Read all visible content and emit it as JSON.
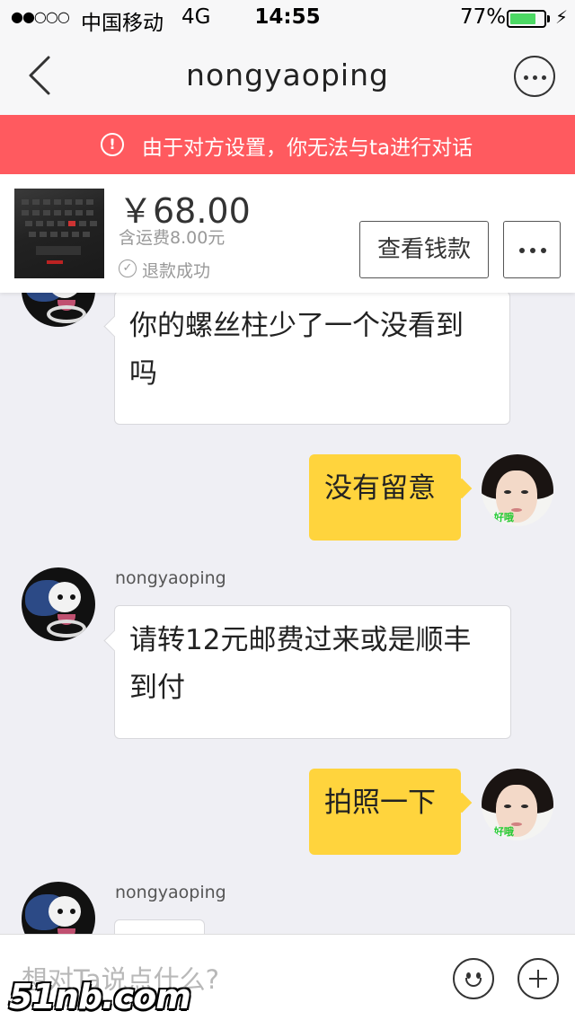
{
  "status_bar": {
    "signal": "●●○○○",
    "carrier": "中国移动",
    "network": "4G",
    "time": "14:55",
    "battery": "77%",
    "battery_level": 0.77
  },
  "nav": {
    "title": "nongyaoping"
  },
  "warning": {
    "text": "由于对方设置，你无法与ta进行对话"
  },
  "product": {
    "price": "￥68.00",
    "shipping": "含运费8.00元",
    "status": "退款成功",
    "view_button": "查看钱款"
  },
  "messages": [
    {
      "from": "other",
      "sender": "",
      "text_line1": "你的螺丝柱少了一个没看到",
      "text_line2": "吗"
    },
    {
      "from": "me",
      "text": "没有留意"
    },
    {
      "from": "other",
      "sender": "nongyaoping",
      "text_line1": "请转12元邮费过来或是顺丰",
      "text_line2": "到付"
    },
    {
      "from": "me",
      "text": "拍照一下"
    },
    {
      "from": "other",
      "sender": "nongyaoping",
      "text_line1": "",
      "text_line2": ""
    }
  ],
  "input": {
    "placeholder": "想对Ta说点什么?"
  },
  "watermark": "51nb.com",
  "colors": {
    "warning_bg": "#ff5a5f",
    "my_bubble": "#ffd43d",
    "battery_fill": "#4cd964"
  }
}
